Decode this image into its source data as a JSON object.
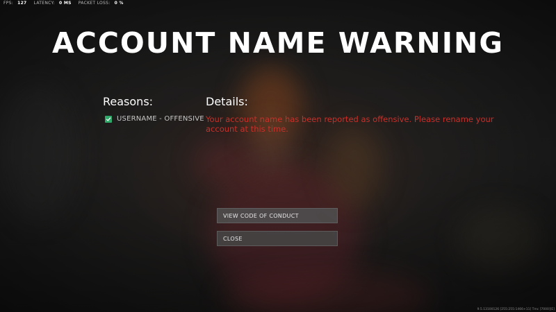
{
  "stats": {
    "fps_label": "FPS:",
    "fps_value": "127",
    "latency_label": "LATENCY:",
    "latency_value": "0 MS",
    "packet_loss_label": "PACKET LOSS:",
    "packet_loss_value": "0 %"
  },
  "title": "ACCOUNT NAME WARNING",
  "reasons": {
    "heading": "Reasons:",
    "items": [
      {
        "label": "USERNAME - OFFENSIVE",
        "checked": true
      }
    ]
  },
  "details": {
    "heading": "Details:",
    "text": "Your account name has been reported as offensive. Please rename your account at this time."
  },
  "buttons": {
    "code_of_conduct": "VIEW CODE OF CONDUCT",
    "close": "CLOSE"
  },
  "build_info": "9.5.13100126 [255:255:1466+11] Tmc [7000][E]",
  "colors": {
    "warning_text": "#c8302a",
    "checkbox": "#2fa86a",
    "title": "#ffffff"
  }
}
